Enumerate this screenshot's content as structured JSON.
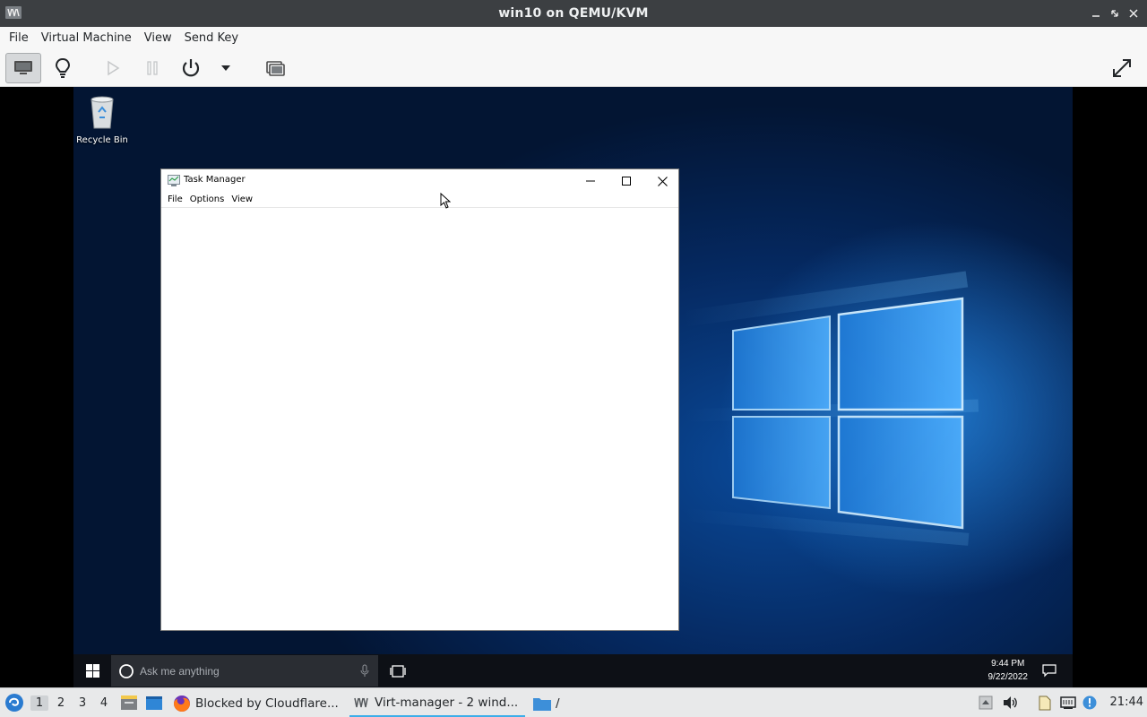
{
  "window": {
    "title": "win10 on QEMU/KVM"
  },
  "menubar": {
    "items": [
      "File",
      "Virtual Machine",
      "View",
      "Send Key"
    ]
  },
  "toolbar": {
    "buttons": [
      {
        "name": "show-console-icon",
        "active": true
      },
      {
        "name": "details-lightbulb-icon",
        "active": false
      },
      {
        "name": "run-icon",
        "enabled": false
      },
      {
        "name": "pause-icon",
        "enabled": false
      },
      {
        "name": "power-icon",
        "enabled": true
      },
      {
        "name": "power-menu-chevron-icon",
        "enabled": true
      },
      {
        "name": "snapshots-icon",
        "enabled": true
      },
      {
        "name": "fullscreen-icon",
        "enabled": true
      }
    ]
  },
  "guest": {
    "desktop_icons": [
      {
        "label": "Recycle Bin"
      }
    ],
    "task_manager": {
      "title": "Task Manager",
      "menu": [
        "File",
        "Options",
        "View"
      ]
    },
    "taskbar": {
      "search_placeholder": "Ask me anything",
      "time": "9:44 PM",
      "date": "9/22/2022"
    }
  },
  "panel": {
    "workspaces": [
      "1",
      "2",
      "3",
      "4"
    ],
    "active_workspace": "1",
    "tasks": [
      {
        "label": "Blocked by Cloudflare...",
        "icon": "firefox-icon"
      },
      {
        "label": "Virt-manager - 2 wind...",
        "icon": "virt-manager-icon",
        "active": true
      },
      {
        "label": "/",
        "icon": "folder-icon"
      }
    ],
    "clock": "21:44"
  }
}
